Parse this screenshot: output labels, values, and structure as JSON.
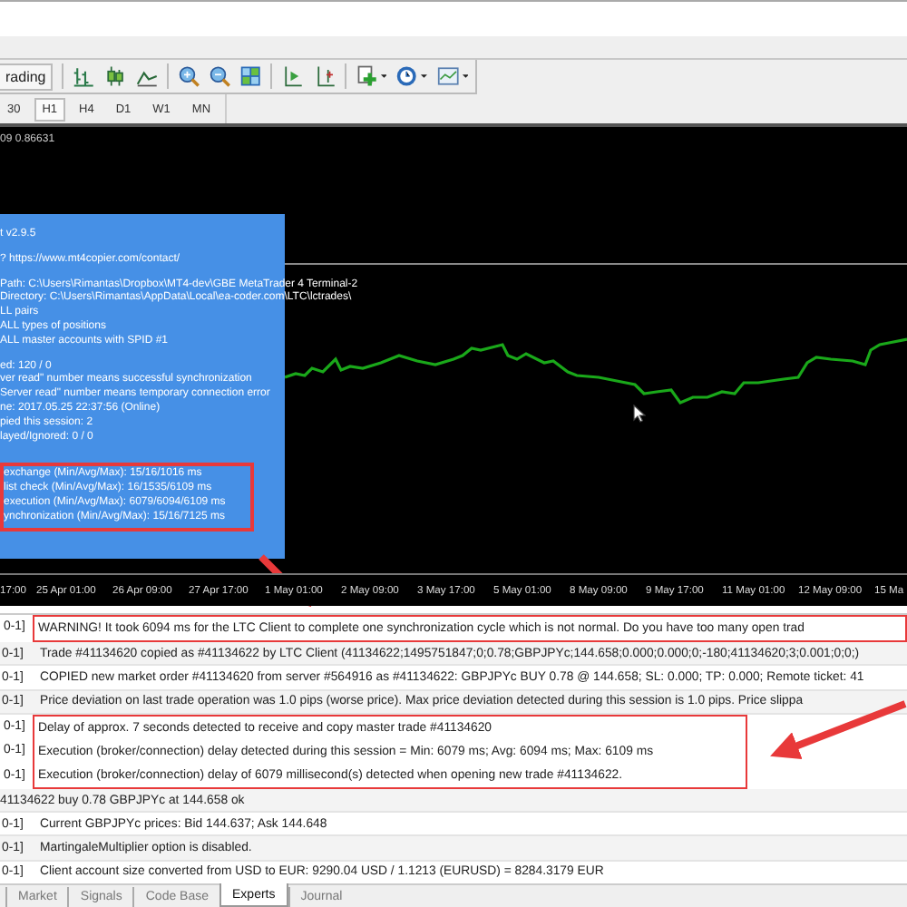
{
  "toolbar": {
    "autotrading_button": "rading",
    "timeframes": [
      {
        "label": "30",
        "selected": false
      },
      {
        "label": "H1",
        "selected": true
      },
      {
        "label": "H4",
        "selected": false
      },
      {
        "label": "D1",
        "selected": false
      },
      {
        "label": "W1",
        "selected": false
      },
      {
        "label": "MN",
        "selected": false
      }
    ]
  },
  "chart": {
    "header": "09 0.86631",
    "info_panel": {
      "groups": [
        {
          "annotated": false,
          "lines": [
            "t v2.9.5"
          ]
        },
        {
          "annotated": false,
          "lines": [
            "? https://www.mt4copier.com/contact/"
          ]
        },
        {
          "annotated": false,
          "lines": [
            "Path: C:\\Users\\Rimantas\\Dropbox\\MT4-dev\\GBE MetaTrader 4 Terminal-2",
            "Directory: C:\\Users\\Rimantas\\AppData\\Local\\ea-coder.com\\LTC\\lctrades\\",
            "LL pairs",
            "ALL types of positions",
            " ALL master accounts with SPID #1"
          ]
        },
        {
          "annotated": false,
          "lines": [
            "ed: 120 / 0",
            "ver read\" number means successful synchronization",
            "Server read\" number means temporary connection error",
            "ne: 2017.05.25 22:37:56 (Online)",
            "pied this session: 2",
            "layed/Ignored: 0 / 0"
          ]
        },
        {
          "annotated": true,
          "lines": [
            "exchange (Min/Avg/Max): 15/16/1016 ms",
            "list check (Min/Avg/Max): 16/1535/6109 ms",
            "execution (Min/Avg/Max): 6079/6094/6109 ms",
            "ynchronization (Min/Avg/Max): 15/16/7125 ms"
          ]
        }
      ]
    },
    "time_axis": [
      "17:00",
      "25 Apr 01:00",
      "26 Apr 09:00",
      "27 Apr 17:00",
      "1 May 01:00",
      "2 May 09:00",
      "3 May 17:00",
      "5 May 01:00",
      "8 May 09:00",
      "9 May 17:00",
      "11 May 01:00",
      "12 May 09:00",
      "15 Ma"
    ]
  },
  "log": {
    "rows": [
      {
        "prefix": "0-1]",
        "message": "WARNING! It took 6094 ms for the LTC Client to complete one synchronization cycle which is not normal. Do you have too many open trad",
        "annotated": true
      },
      {
        "prefix": "0-1]",
        "message": "Trade #41134620 copied as #41134622 by LTC Client (41134622;1495751847;0;0.78;GBPJPYc;144.658;0.000;0.000;0;-180;41134620;3;0.001;0;0;)",
        "annotated": false
      },
      {
        "prefix": "0-1]",
        "message": "COPIED new market order #41134620 from server #564916 as #41134622: GBPJPYc BUY 0.78 @ 144.658; SL: 0.000; TP: 0.000; Remote ticket: 41",
        "annotated": false
      },
      {
        "prefix": "0-1]",
        "message": "Price deviation on last trade operation was 1.0 pips (worse price). Max price deviation detected during this session is 1.0 pips. Price slippa",
        "annotated": false
      },
      {
        "prefix": "0-1]",
        "message": "Delay of approx. 7 seconds detected to receive and copy master trade #41134620",
        "annotated": true
      },
      {
        "prefix": "0-1]",
        "message": "Execution (broker/connection) delay detected during this session = Min: 6079 ms; Avg: 6094 ms; Max: 6109 ms",
        "annotated": true
      },
      {
        "prefix": "0-1]",
        "message": "Execution (broker/connection) delay of 6079 millisecond(s) detected when opening new trade #41134622.",
        "annotated": true
      },
      {
        "message": "41134622 buy 0.78 GBPJPYc at 144.658 ok",
        "annotated": false
      },
      {
        "prefix": "0-1]",
        "message": "Current GBPJPYc prices: Bid 144.637; Ask 144.648",
        "annotated": false
      },
      {
        "prefix": "0-1]",
        "message": "MartingaleMultiplier option is disabled.",
        "annotated": false
      },
      {
        "prefix": "0-1]",
        "message": "Client account size converted from USD to EUR: 9290.04 USD / 1.1213 (EURUSD) = 8284.3179 EUR",
        "annotated": false
      }
    ]
  },
  "tabs": [
    {
      "label": "Market",
      "selected": false
    },
    {
      "label": "Signals",
      "selected": false
    },
    {
      "label": "Code Base",
      "selected": false
    },
    {
      "label": "Experts",
      "selected": true
    },
    {
      "label": "Journal",
      "selected": false
    }
  ]
}
